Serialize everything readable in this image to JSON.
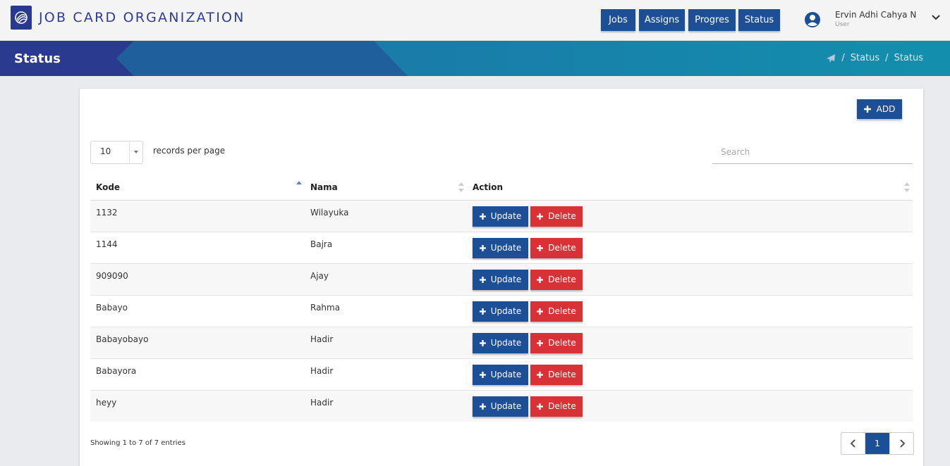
{
  "header": {
    "brand": "JOB CARD ORGANIZATION",
    "logo_icon": "globe-icon",
    "nav": [
      {
        "label": "Jobs"
      },
      {
        "label": "Assigns"
      },
      {
        "label": "Progres"
      },
      {
        "label": "Status"
      }
    ],
    "user": {
      "name": "Ervin Adhi Cahya N",
      "role": "User"
    }
  },
  "banner": {
    "title": "Status",
    "breadcrumb": [
      "Status",
      "Status"
    ],
    "home_icon": "plane-icon"
  },
  "toolbar": {
    "add_label": "ADD"
  },
  "table_controls": {
    "page_length": "10",
    "length_label": "records per page",
    "search_placeholder": "Search"
  },
  "table": {
    "columns": [
      "Kode",
      "Nama",
      "Action"
    ],
    "rows": [
      {
        "kode": "1132",
        "nama": "Wilayuka"
      },
      {
        "kode": "1144",
        "nama": "Bajra"
      },
      {
        "kode": "909090",
        "nama": "Ajay"
      },
      {
        "kode": "Babayo",
        "nama": "Rahma"
      },
      {
        "kode": "Babayobayo",
        "nama": "Hadir"
      },
      {
        "kode": "Babayora",
        "nama": "Hadir"
      },
      {
        "kode": "heyy",
        "nama": "Hadir"
      }
    ],
    "update_label": "Update",
    "delete_label": "Delete"
  },
  "footer": {
    "info": "Showing 1 to 7 of 7 entries",
    "current_page": "1"
  },
  "colors": {
    "primary": "#1d4f96",
    "danger": "#d83236",
    "brand_text": "#2e3d8f",
    "banner_dark": "#2a3b8f",
    "banner_light": "#1a95b0"
  }
}
